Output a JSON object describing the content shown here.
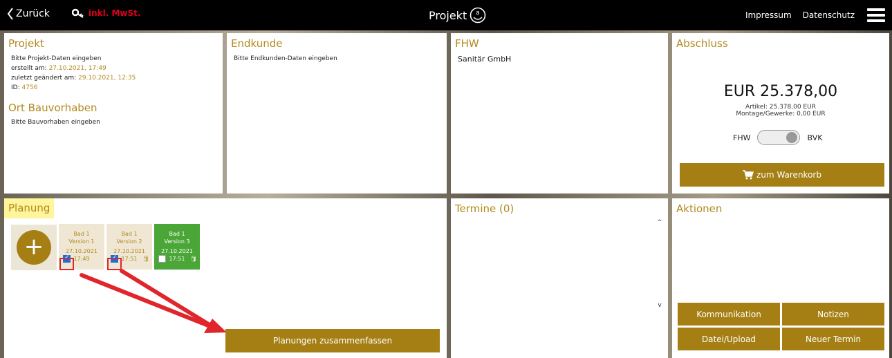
{
  "topbar": {
    "back_label": "Zurück",
    "mwst_label": "inkl. MwSt.",
    "title": "Projekt",
    "impressum": "Impressum",
    "datenschutz": "Datenschutz"
  },
  "projekt": {
    "title": "Projekt",
    "hint": "Bitte Projekt-Daten eingeben",
    "created_label": "erstellt am:",
    "created_value": "27.10.2021, 17:49",
    "changed_label": "zuletzt geändert am:",
    "changed_value": "29.10.2021, 12:35",
    "id_label": "ID:",
    "id_value": "4756",
    "ort_title": "Ort Bauvorhaben",
    "ort_hint": "Bitte Bauvorhaben eingeben"
  },
  "endkunde": {
    "title": "Endkunde",
    "hint": "Bitte Endkunden-Daten eingeben"
  },
  "fhw": {
    "title": "FHW",
    "company": "Sanitär GmbH"
  },
  "abschluss": {
    "title": "Abschluss",
    "amount": "EUR 25.378,00",
    "artikel": "Artikel: 25.378,00 EUR",
    "montage": "Montage/Gewerke: 0,00 EUR",
    "toggle_left": "FHW",
    "toggle_right": "BVK",
    "cart_button": "zum Warenkorb"
  },
  "planung": {
    "title": "Planung",
    "versions": [
      {
        "name": "Bad 1",
        "version": "Version 1",
        "date": "27.10.2021",
        "time": "17:49",
        "checked": true
      },
      {
        "name": "Bad 1",
        "version": "Version 2",
        "date": "27.10.2021",
        "time": "17:51",
        "checked": true
      },
      {
        "name": "Bad 1",
        "version": "Version 3",
        "date": "27.10.2021",
        "time": "17:51",
        "checked": false
      }
    ],
    "merge_button": "Planungen zusammenfassen"
  },
  "termine": {
    "title": "Termine (0)"
  },
  "aktionen": {
    "title": "Aktionen",
    "buttons": [
      "Kommunikation",
      "Notizen",
      "Datei/Upload",
      "Neuer Termin"
    ]
  },
  "colors": {
    "accent": "#a57f14",
    "title_gold": "#b08a1e",
    "active_version": "#4aa636",
    "annotation_red": "#e0262b"
  }
}
